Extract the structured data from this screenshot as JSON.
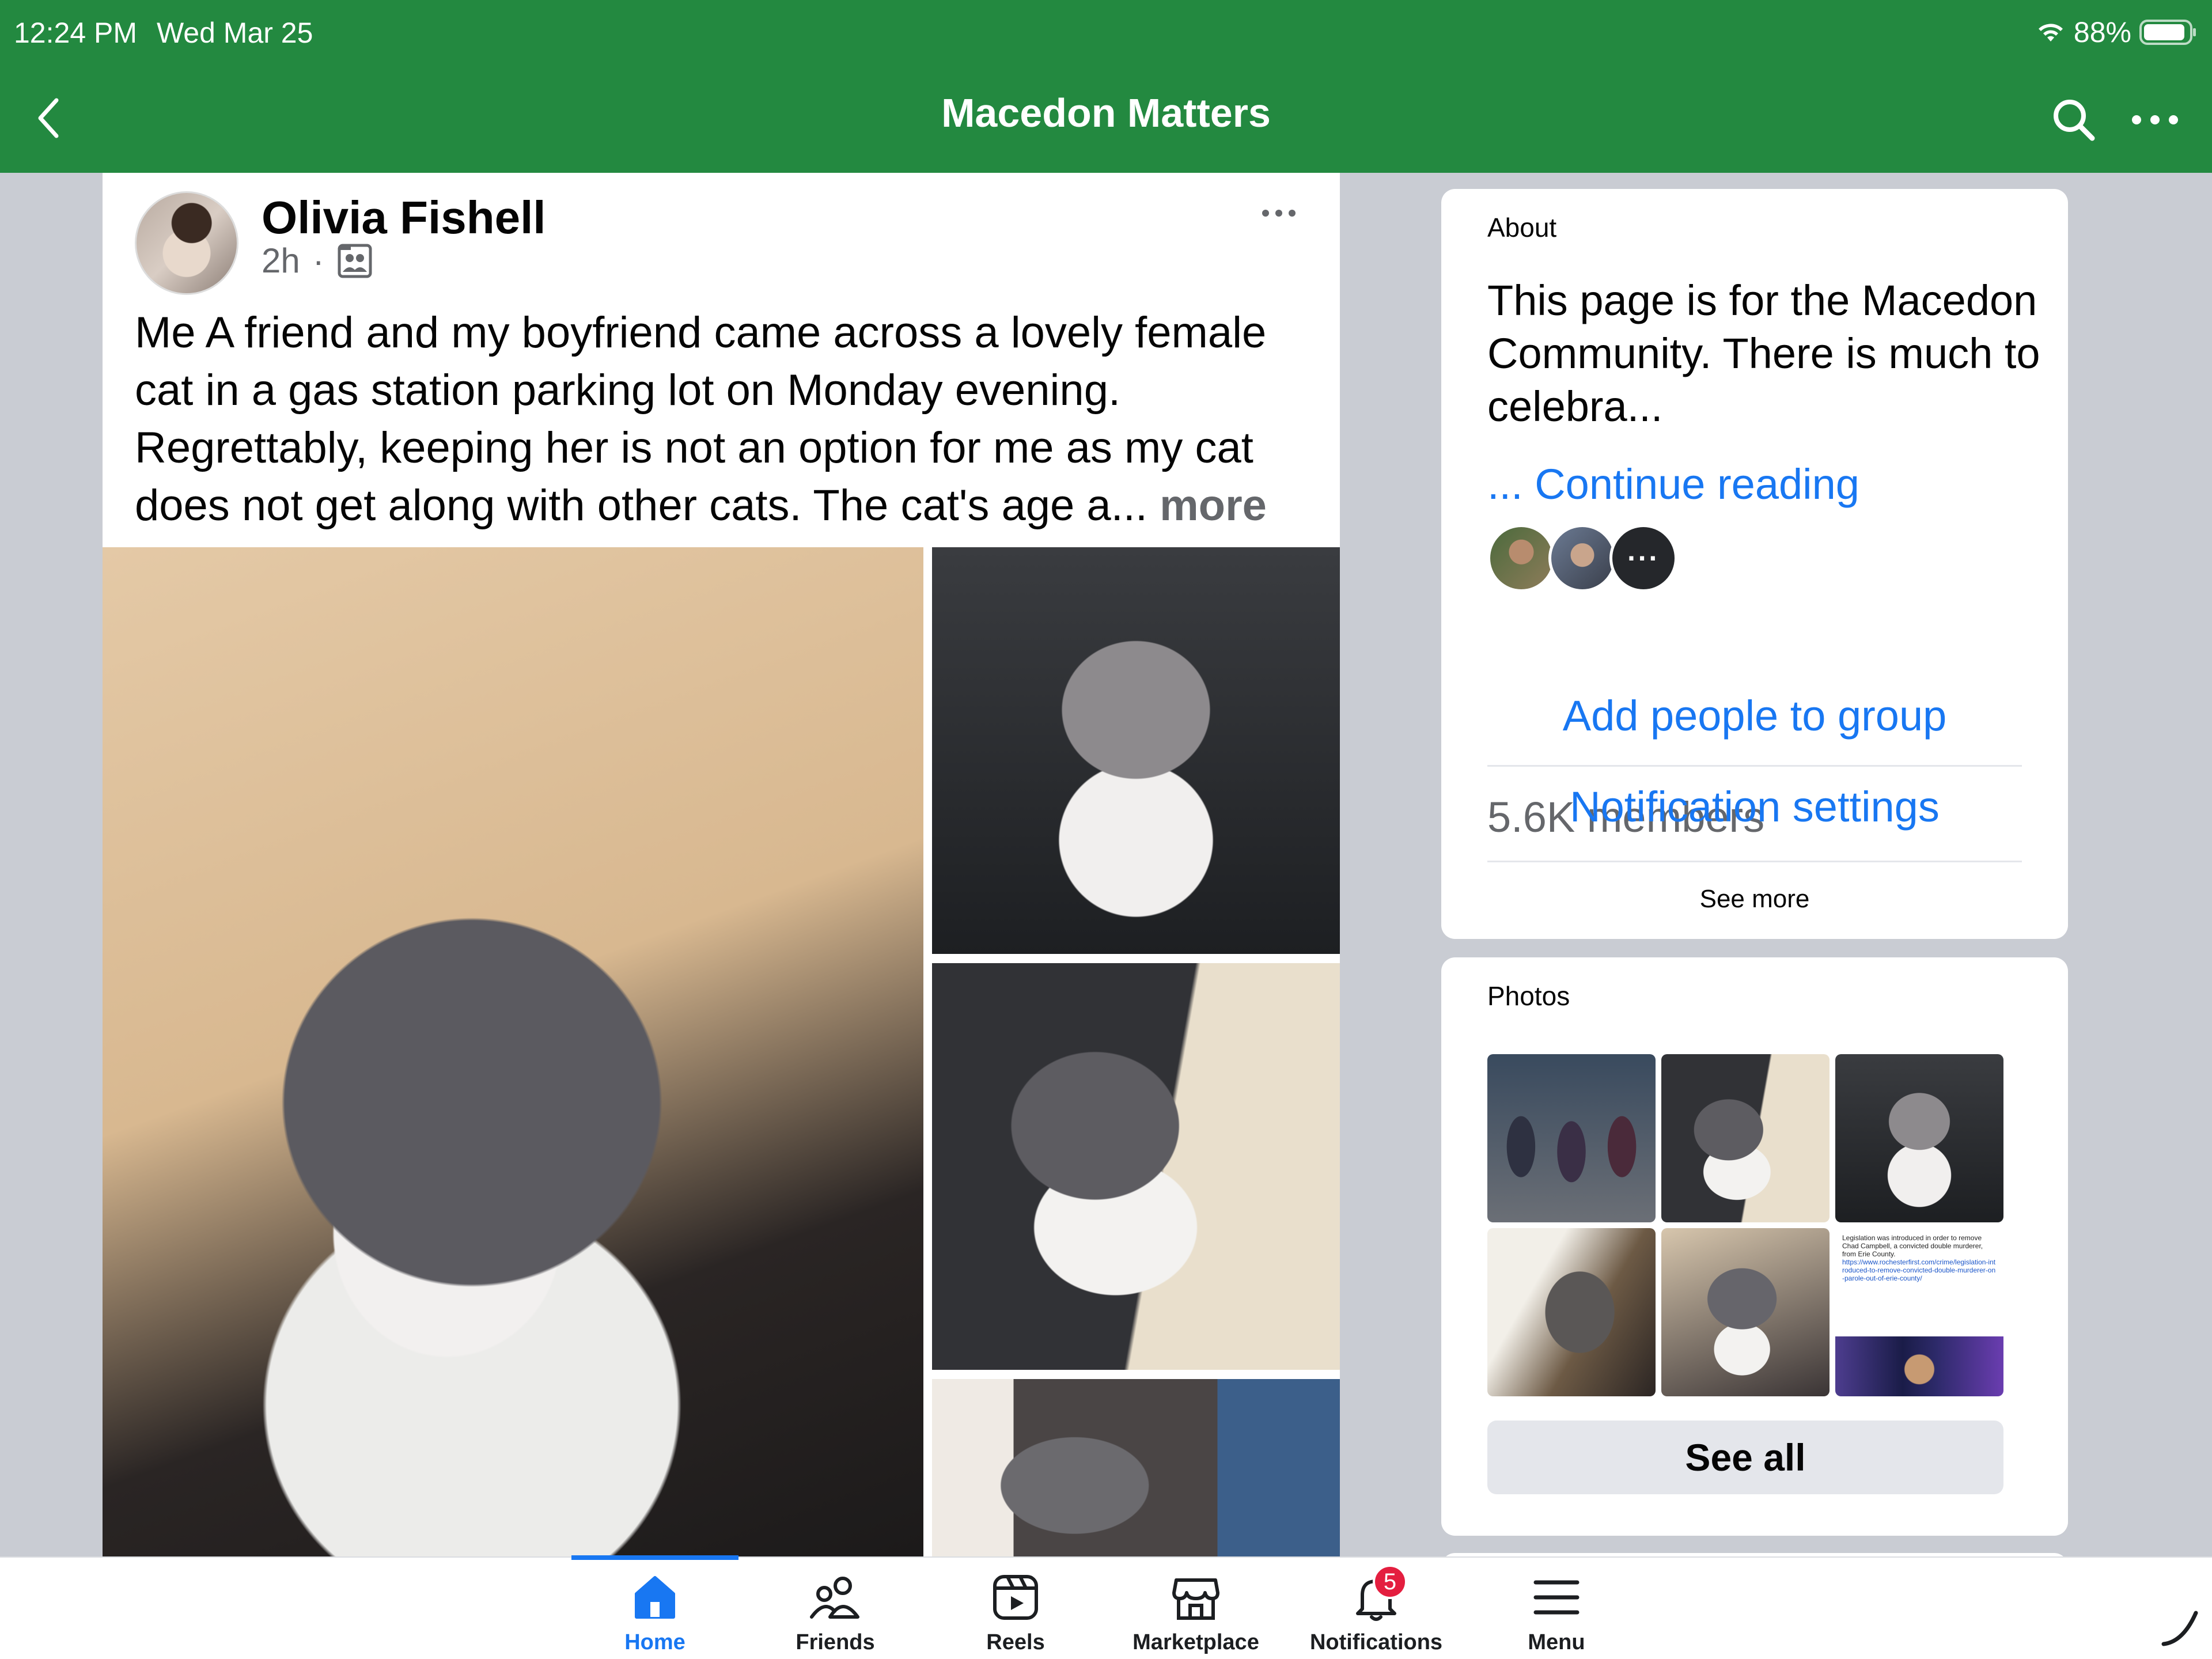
{
  "status_bar": {
    "time": "12:24 PM",
    "date": "Wed Mar 25",
    "battery": "88%",
    "battery_level": 0.88,
    "icons": [
      "wifi-icon",
      "battery-icon"
    ]
  },
  "header": {
    "title": "Macedon Matters",
    "icons": [
      "back-chevron-icon",
      "search-icon",
      "more-horizontal-icon"
    ],
    "color": "#238940"
  },
  "post": {
    "author": "Olivia Fishell",
    "time": "2h",
    "separator": "·",
    "audience_icon": "members-group-icon",
    "text": "Me A friend and my boyfriend came across a lovely female cat in a gas station parking lot on Monday evening. Regrettably, keeping her is not an option for me as my cat does not get along with other cats. The cat's age a...",
    "more_label": "more",
    "photos": [
      "cat-photo-main",
      "cat-photo-cage",
      "cat-photo-held",
      "cat-photo-floor"
    ]
  },
  "about": {
    "heading": "About",
    "description": "This page is for the Macedon Community. There is much to celebra...",
    "continue_label": "... Continue reading",
    "more_avatars_label": "···",
    "members": "5.6K members",
    "add_people_label": "Add people to group",
    "notification_settings_label": "Notification settings",
    "see_more_label": "See more"
  },
  "photos": {
    "heading": "Photos",
    "see_all_label": "See all",
    "legislation_thumb": {
      "text": "Legislation was introduced in order to remove Chad Campbell, a convicted double murderer, from Erie County.",
      "url": "https://www.rochesterfirst.com/crime/legislation-introduced-to-remove-convicted-double-murderer-on-parole-out-of-erie-county/"
    }
  },
  "tabbar": {
    "accent": "#1877f2",
    "tabs": [
      {
        "label": "Home",
        "icon": "home-icon",
        "active": true
      },
      {
        "label": "Friends",
        "icon": "friends-icon"
      },
      {
        "label": "Reels",
        "icon": "reels-icon"
      },
      {
        "label": "Marketplace",
        "icon": "marketplace-icon"
      },
      {
        "label": "Notifications",
        "icon": "bell-icon",
        "badge": "5"
      },
      {
        "label": "Menu",
        "icon": "hamburger-menu-icon"
      }
    ]
  }
}
